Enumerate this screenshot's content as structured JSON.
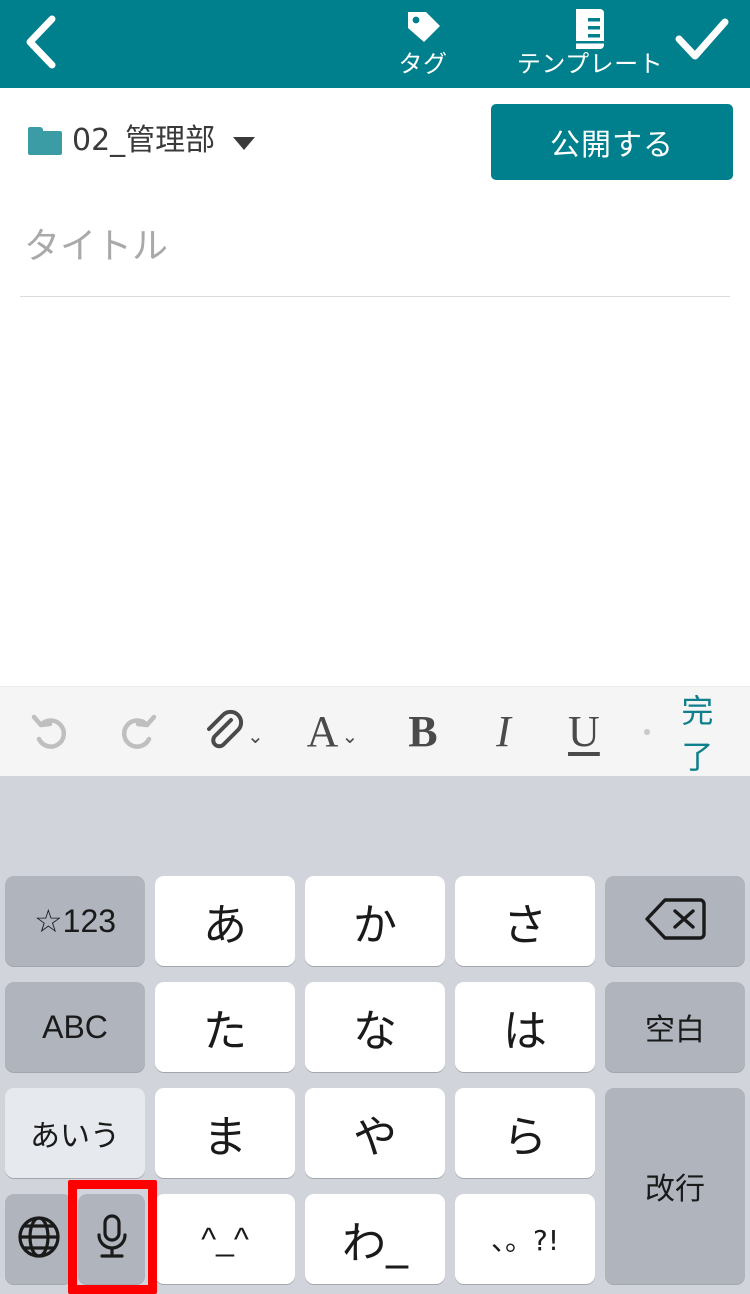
{
  "navbar": {
    "back_icon": "chevron-left-icon",
    "actions": [
      {
        "id": "tag",
        "icon": "tag-icon",
        "label": "タグ"
      },
      {
        "id": "template",
        "icon": "template-document-icon",
        "label": "テンプレート"
      }
    ],
    "confirm_icon": "check-icon",
    "background_color": "#00808C"
  },
  "folder_row": {
    "folder_icon": "folder-icon",
    "folder_name": "02_管理部",
    "dropdown_icon": "caret-down-icon",
    "publish_label": "公開する",
    "publish_color": "#00808C"
  },
  "editor": {
    "title_placeholder": "タイトル",
    "title_value": "",
    "body_value": ""
  },
  "toolbar": {
    "undo_icon": "undo-icon",
    "redo_icon": "redo-icon",
    "attach_icon": "paperclip-icon",
    "attach_chevron": "chevron-down-icon",
    "font_glyph": "A",
    "font_chevron": "chevron-down-icon",
    "bold_glyph": "B",
    "italic_glyph": "I",
    "underline_glyph": "U",
    "separator": "dot-separator",
    "done_label": "完了",
    "done_color": "#0F7F8C",
    "background_color": "#F5F5F5"
  },
  "keyboard": {
    "background_color": "#D1D5DB",
    "white_key_color": "#FFFFFF",
    "gray_key_color": "#AFB4BD",
    "active_key_color": "#E6E9EE",
    "keys": [
      {
        "id": "num-symbol",
        "label": "☆123",
        "type": "gray",
        "style": "ascii"
      },
      {
        "id": "kana-a",
        "label": "あ",
        "type": "white",
        "style": "kana"
      },
      {
        "id": "kana-ka",
        "label": "か",
        "type": "white",
        "style": "kana"
      },
      {
        "id": "kana-sa",
        "label": "さ",
        "type": "white",
        "style": "kana"
      },
      {
        "id": "delete",
        "label": "",
        "type": "gray",
        "style": "icon",
        "icon": "backspace-icon"
      },
      {
        "id": "abc",
        "label": "ABC",
        "type": "gray",
        "style": "ascii"
      },
      {
        "id": "kana-ta",
        "label": "た",
        "type": "white",
        "style": "kana"
      },
      {
        "id": "kana-na",
        "label": "な",
        "type": "white",
        "style": "kana"
      },
      {
        "id": "kana-ha",
        "label": "は",
        "type": "white",
        "style": "kana"
      },
      {
        "id": "space",
        "label": "空白",
        "type": "gray",
        "style": "label"
      },
      {
        "id": "aiu",
        "label": "あいう",
        "type": "light",
        "style": "label"
      },
      {
        "id": "kana-ma",
        "label": "ま",
        "type": "white",
        "style": "kana"
      },
      {
        "id": "kana-ya",
        "label": "や",
        "type": "white",
        "style": "kana"
      },
      {
        "id": "kana-ra",
        "label": "ら",
        "type": "white",
        "style": "kana"
      },
      {
        "id": "enter",
        "label": "改行",
        "type": "gray",
        "style": "label"
      },
      {
        "id": "globe",
        "label": "",
        "type": "gray",
        "style": "icon",
        "icon": "globe-icon"
      },
      {
        "id": "mic",
        "label": "",
        "type": "gray",
        "style": "icon",
        "icon": "microphone-icon"
      },
      {
        "id": "emoji",
        "label": "^_^",
        "type": "white",
        "style": "ascii"
      },
      {
        "id": "kana-wa",
        "label": "わ_",
        "type": "white",
        "style": "kana"
      },
      {
        "id": "punct",
        "label": "、。?!",
        "type": "white",
        "style": "label-sm"
      }
    ]
  },
  "annotation": {
    "highlight_target": "mic",
    "highlight_color": "#FF0000"
  }
}
